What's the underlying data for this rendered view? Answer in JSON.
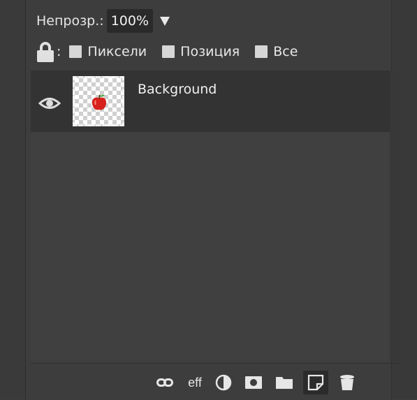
{
  "opacity": {
    "label": "Непрозр.:",
    "value": "100%"
  },
  "lock": {
    "colon": ":",
    "options": [
      {
        "label": "Пиксели",
        "checked": false
      },
      {
        "label": "Позиция",
        "checked": false
      },
      {
        "label": "Все",
        "checked": false
      }
    ]
  },
  "layers": [
    {
      "name": "Background",
      "visible": true,
      "icon": "eye-icon"
    }
  ],
  "toolbar": {
    "effects_label": "eff",
    "icons": [
      "link-icon",
      "effects-icon",
      "adjustment-icon",
      "mask-icon",
      "folder-icon",
      "new-layer-icon",
      "trash-icon"
    ]
  },
  "colors": {
    "panel_bg": "#404040",
    "selected_row": "#333333",
    "text": "#e8e8e8"
  }
}
